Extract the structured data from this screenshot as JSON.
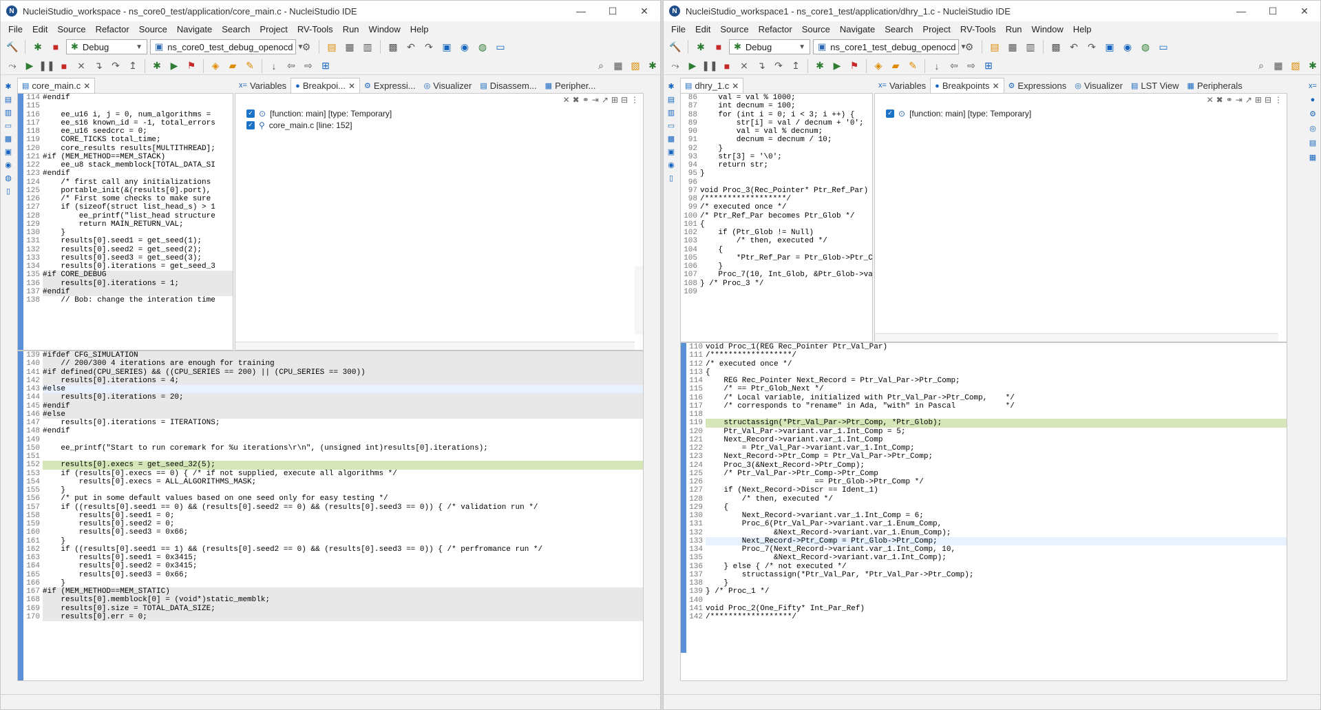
{
  "left": {
    "title": "NucleiStudio_workspace - ns_core0_test/application/core_main.c - NucleiStudio IDE",
    "menu": [
      "File",
      "Edit",
      "Source",
      "Refactor",
      "Source",
      "Navigate",
      "Search",
      "Project",
      "RV-Tools",
      "Run",
      "Window",
      "Help"
    ],
    "mode": "Debug",
    "launch": "ns_core0_test_debug_openocd",
    "editor_tab": "core_main.c",
    "view_tabs": [
      "Variables",
      "Breakpoi...",
      "Expressi...",
      "Visualizer",
      "Disassem...",
      "Peripher..."
    ],
    "breakpoints": [
      "[function: main] [type: Temporary]",
      "core_main.c [line: 152]"
    ],
    "code": [
      [
        "114",
        "#endif"
      ],
      [
        "115",
        ""
      ],
      [
        "116",
        "    ee_u16 i, j = 0, num_algorithms ="
      ],
      [
        "117",
        "    ee_s16 known_id = -1, total_errors"
      ],
      [
        "118",
        "    ee_u16 seedcrc = 0;"
      ],
      [
        "119",
        "    CORE_TICKS total_time;"
      ],
      [
        "120",
        "    core_results results[MULTITHREAD];"
      ],
      [
        "121",
        "#if (MEM_METHOD==MEM_STACK)"
      ],
      [
        "122",
        "    ee_u8 stack_memblock[TOTAL_DATA_SI"
      ],
      [
        "123",
        "#endif"
      ],
      [
        "124",
        "    /* first call any initializations"
      ],
      [
        "125",
        "    portable_init(&(results[0].port),"
      ],
      [
        "126",
        "    /* First some checks to make sure"
      ],
      [
        "127",
        "    if (sizeof(struct list_head_s) > 1"
      ],
      [
        "128",
        "        ee_printf(\"list_head structure"
      ],
      [
        "129",
        "        return MAIN_RETURN_VAL;"
      ],
      [
        "130",
        "    }"
      ],
      [
        "131",
        "    results[0].seed1 = get_seed(1);"
      ],
      [
        "132",
        "    results[0].seed2 = get_seed(2);"
      ],
      [
        "133",
        "    results[0].seed3 = get_seed(3);"
      ],
      [
        "134",
        "    results[0].iterations = get_seed_3"
      ],
      [
        "135",
        "#if CORE_DEBUG"
      ],
      [
        "136",
        "    results[0].iterations = 1;"
      ],
      [
        "137",
        "#endif"
      ],
      [
        "138",
        "    // Bob: change the interation time"
      ],
      [
        "139",
        "#ifdef CFG_SIMULATION"
      ],
      [
        "140",
        "    // 200/300 4 iterations are enough for training"
      ],
      [
        "141",
        "#if defined(CPU_SERIES) && ((CPU_SERIES == 200) || (CPU_SERIES == 300))"
      ],
      [
        "142",
        "    results[0].iterations = 4;"
      ],
      [
        "143",
        "#else"
      ],
      [
        "144",
        "    results[0].iterations = 20;"
      ],
      [
        "145",
        "#endif"
      ],
      [
        "146",
        "#else"
      ],
      [
        "147",
        "    results[0].iterations = ITERATIONS;"
      ],
      [
        "148",
        "#endif"
      ],
      [
        "149",
        ""
      ],
      [
        "150",
        "    ee_printf(\"Start to run coremark for %u iterations\\r\\n\", (unsigned int)results[0].iterations);"
      ],
      [
        "151",
        ""
      ],
      [
        "152",
        "    results[0].execs = get_seed_32(5);"
      ],
      [
        "153",
        "    if (results[0].execs == 0) { /* if not supplied, execute all algorithms */"
      ],
      [
        "154",
        "        results[0].execs = ALL_ALGORITHMS_MASK;"
      ],
      [
        "155",
        "    }"
      ],
      [
        "156",
        "    /* put in some default values based on one seed only for easy testing */"
      ],
      [
        "157",
        "    if ((results[0].seed1 == 0) && (results[0].seed2 == 0) && (results[0].seed3 == 0)) { /* validation run */"
      ],
      [
        "158",
        "        results[0].seed1 = 0;"
      ],
      [
        "159",
        "        results[0].seed2 = 0;"
      ],
      [
        "160",
        "        results[0].seed3 = 0x66;"
      ],
      [
        "161",
        "    }"
      ],
      [
        "162",
        "    if ((results[0].seed1 == 1) && (results[0].seed2 == 0) && (results[0].seed3 == 0)) { /* perfromance run */"
      ],
      [
        "163",
        "        results[0].seed1 = 0x3415;"
      ],
      [
        "164",
        "        results[0].seed2 = 0x3415;"
      ],
      [
        "165",
        "        results[0].seed3 = 0x66;"
      ],
      [
        "166",
        "    }"
      ],
      [
        "167",
        "#if (MEM_METHOD==MEM_STATIC)"
      ],
      [
        "168",
        "    results[0].memblock[0] = (void*)static_memblk;"
      ],
      [
        "169",
        "    results[0].size = TOTAL_DATA_SIZE;"
      ],
      [
        "170",
        "    results[0].err = 0;"
      ]
    ]
  },
  "right": {
    "title": "NucleiStudio_workspace1 - ns_core1_test/application/dhry_1.c - NucleiStudio IDE",
    "menu": [
      "File",
      "Edit",
      "Source",
      "Refactor",
      "Source",
      "Navigate",
      "Search",
      "Project",
      "RV-Tools",
      "Run",
      "Window",
      "Help"
    ],
    "mode": "Debug",
    "launch": "ns_core1_test_debug_openocd",
    "editor_tab": "dhry_1.c",
    "view_tabs": [
      "Variables",
      "Breakpoints",
      "Expressions",
      "Visualizer",
      "LST View",
      "Peripherals"
    ],
    "breakpoints": [
      "[function: main] [type: Temporary]"
    ],
    "code_top": [
      [
        "86",
        "    val = val % 1000;"
      ],
      [
        "87",
        "    int decnum = 100;"
      ],
      [
        "88",
        "    for (int i = 0; i < 3; i ++) {"
      ],
      [
        "89",
        "        str[i] = val / decnum + '0';"
      ],
      [
        "90",
        "        val = val % decnum;"
      ],
      [
        "91",
        "        decnum = decnum / 10;"
      ],
      [
        "92",
        "    }"
      ],
      [
        "93",
        "    str[3] = '\\0';"
      ],
      [
        "94",
        "    return str;"
      ],
      [
        "95",
        "}"
      ],
      [
        "96",
        ""
      ],
      [
        "97",
        "void Proc_3(Rec_Pointer* Ptr_Ref_Par)"
      ],
      [
        "98",
        "/******************/"
      ],
      [
        "99",
        "/* executed once */"
      ],
      [
        "100",
        "/* Ptr_Ref_Par becomes Ptr_Glob */"
      ],
      [
        "101",
        "{"
      ],
      [
        "102",
        "    if (Ptr_Glob != Null)"
      ],
      [
        "103",
        "        /* then, executed */"
      ],
      [
        "104",
        "    {"
      ],
      [
        "105",
        "        *Ptr_Ref_Par = Ptr_Glob->Ptr_C"
      ],
      [
        "106",
        "    }"
      ],
      [
        "107",
        "    Proc_7(10, Int_Glob, &Ptr_Glob->va"
      ],
      [
        "108",
        "} /* Proc_3 */"
      ],
      [
        "109",
        ""
      ]
    ],
    "code_bottom": [
      [
        "110",
        "void Proc_1(REG Rec_Pointer Ptr_Val_Par)"
      ],
      [
        "111",
        "/******************/"
      ],
      [
        "112",
        "/* executed once */"
      ],
      [
        "113",
        "{"
      ],
      [
        "114",
        "    REG Rec_Pointer Next_Record = Ptr_Val_Par->Ptr_Comp;"
      ],
      [
        "115",
        "    /* == Ptr_Glob_Next */"
      ],
      [
        "116",
        "    /* Local variable, initialized with Ptr_Val_Par->Ptr_Comp,    */"
      ],
      [
        "117",
        "    /* corresponds to \"rename\" in Ada, \"with\" in Pascal           */"
      ],
      [
        "118",
        ""
      ],
      [
        "119",
        "    structassign(*Ptr_Val_Par->Ptr_Comp, *Ptr_Glob);"
      ],
      [
        "120",
        "    Ptr_Val_Par->variant.var_1.Int_Comp = 5;"
      ],
      [
        "121",
        "    Next_Record->variant.var_1.Int_Comp"
      ],
      [
        "122",
        "        = Ptr_Val_Par->variant.var_1.Int_Comp;"
      ],
      [
        "123",
        "    Next_Record->Ptr_Comp = Ptr_Val_Par->Ptr_Comp;"
      ],
      [
        "124",
        "    Proc_3(&Next_Record->Ptr_Comp);"
      ],
      [
        "125",
        "    /* Ptr_Val_Par->Ptr_Comp->Ptr_Comp"
      ],
      [
        "126",
        "                        == Ptr_Glob->Ptr_Comp */"
      ],
      [
        "127",
        "    if (Next_Record->Discr == Ident_1)"
      ],
      [
        "128",
        "        /* then, executed */"
      ],
      [
        "129",
        "    {"
      ],
      [
        "130",
        "        Next_Record->variant.var_1.Int_Comp = 6;"
      ],
      [
        "131",
        "        Proc_6(Ptr_Val_Par->variant.var_1.Enum_Comp,"
      ],
      [
        "132",
        "               &Next_Record->variant.var_1.Enum_Comp);"
      ],
      [
        "133",
        "        Next_Record->Ptr_Comp = Ptr_Glob->Ptr_Comp;"
      ],
      [
        "134",
        "        Proc_7(Next_Record->variant.var_1.Int_Comp, 10,"
      ],
      [
        "135",
        "               &Next_Record->variant.var_1.Int_Comp);"
      ],
      [
        "136",
        "    } else { /* not executed */"
      ],
      [
        "137",
        "        structassign(*Ptr_Val_Par, *Ptr_Val_Par->Ptr_Comp);"
      ],
      [
        "138",
        "    }"
      ],
      [
        "139",
        "} /* Proc_1 */"
      ],
      [
        "140",
        ""
      ],
      [
        "141",
        "void Proc_2(One_Fifty* Int_Par_Ref)"
      ],
      [
        "142",
        "/******************/"
      ]
    ]
  }
}
